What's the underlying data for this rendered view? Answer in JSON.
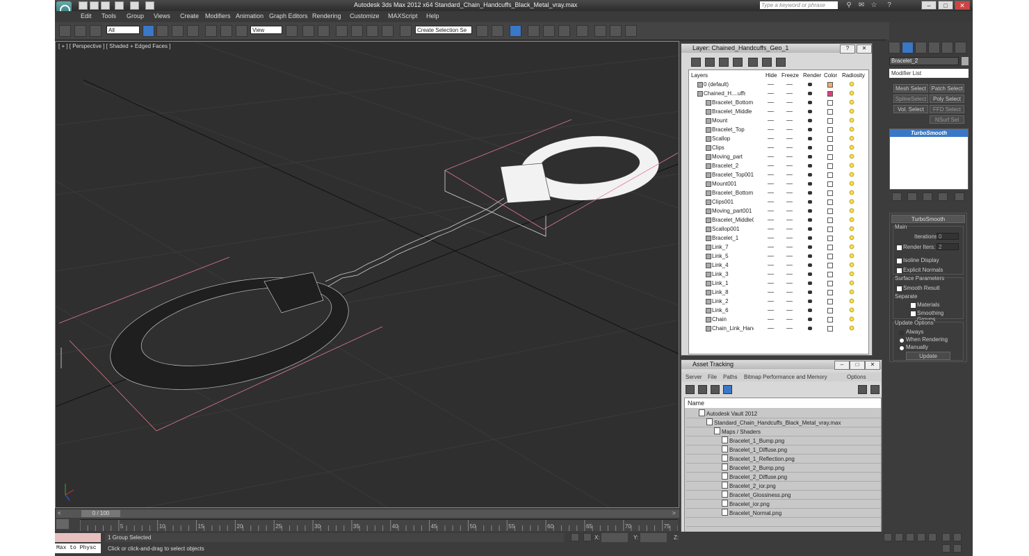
{
  "app": {
    "title": "Autodesk 3ds Max  2012 x64      Standard_Chain_Handcuffs_Black_Metal_vray.max",
    "search_placeholder": "Type a keyword or phrase"
  },
  "menu": [
    "Edit",
    "Tools",
    "Group",
    "Views",
    "Create",
    "Modifiers",
    "Animation",
    "Graph Editors",
    "Rendering",
    "Customize",
    "MAXScript",
    "Help"
  ],
  "toolbar": {
    "filter_select": "All",
    "refcoord_select": "View",
    "selection_set": "Create Selection Se"
  },
  "viewport": {
    "label": "[ + ] [ Perspective ] [ Shaded + Edged Faces ]"
  },
  "layer_panel": {
    "title": "Layer: Chained_Handcuffs_Geo_1",
    "columns": [
      "Layers",
      "Hide",
      "Freeze",
      "Render",
      "Color",
      "Radiosity"
    ],
    "rows": [
      {
        "name": "0 (default)",
        "color": "#e8b070"
      },
      {
        "name": "Chained_H....uffs_G",
        "color": "#e0407a"
      },
      {
        "name": "Bracelet_Bottom"
      },
      {
        "name": "Bracelet_Middle"
      },
      {
        "name": "Mount"
      },
      {
        "name": "Bracelet_Top"
      },
      {
        "name": "Scallop"
      },
      {
        "name": "Clips"
      },
      {
        "name": "Moving_part"
      },
      {
        "name": "Bracelet_2"
      },
      {
        "name": "Bracelet_Top001"
      },
      {
        "name": "Mount001"
      },
      {
        "name": "Bracelet_Bottom"
      },
      {
        "name": "Clips001"
      },
      {
        "name": "Moving_part001"
      },
      {
        "name": "Bracelet_MiddleC"
      },
      {
        "name": "Scallop001"
      },
      {
        "name": "Bracelet_1"
      },
      {
        "name": "Link_7"
      },
      {
        "name": "Link_5"
      },
      {
        "name": "Link_4"
      },
      {
        "name": "Link_3"
      },
      {
        "name": "Link_1"
      },
      {
        "name": "Link_8"
      },
      {
        "name": "Link_2"
      },
      {
        "name": "Link_6"
      },
      {
        "name": "Chain"
      },
      {
        "name": "Chain_Link_Hanc"
      }
    ]
  },
  "asset_panel": {
    "title": "Asset Tracking",
    "menu": [
      "Server",
      "File",
      "Paths",
      "Bitmap Performance and Memory",
      "Options"
    ],
    "column": "Name",
    "rows": [
      {
        "name": "Autodesk Vault 2012",
        "level": 0
      },
      {
        "name": "Standard_Chain_Handcuffs_Black_Metal_vray.max",
        "level": 1
      },
      {
        "name": "Maps / Shaders",
        "level": 2
      },
      {
        "name": "Bracelet_1_Bump.png",
        "level": 3
      },
      {
        "name": "Bracelet_1_Diffuse.png",
        "level": 3
      },
      {
        "name": "Bracelet_1_Reflection.png",
        "level": 3
      },
      {
        "name": "Bracelet_2_Bump.png",
        "level": 3
      },
      {
        "name": "Bracelet_2_Diffuse.png",
        "level": 3
      },
      {
        "name": "Bracelet_2_ior.png",
        "level": 3
      },
      {
        "name": "Bracelet_Glossiness.png",
        "level": 3
      },
      {
        "name": "Bracelet_ior.png",
        "level": 3
      },
      {
        "name": "Bracelet_Normal.png",
        "level": 3
      }
    ]
  },
  "command_panel": {
    "object_name": "Bracelet_2",
    "modifier_list": "Modifier List",
    "buttons": [
      "Mesh Select",
      "Patch Select",
      "SplineSelect",
      "Poly Select",
      "Vol. Select",
      "FFD Select",
      "NSurf Sel"
    ],
    "stack_item": "TurboSmooth",
    "rollout_title": "TurboSmooth",
    "main_label": "Main",
    "iterations_label": "Iterations:",
    "iterations_value": "0",
    "render_iters_label": "Render Iters:",
    "render_iters_value": "2",
    "isoline": "Isoline Display",
    "explicit_normals": "Explicit Normals",
    "surface_params": "Surface Parameters",
    "smooth_result": "Smooth Result",
    "separate": "Separate",
    "materials": "Materials",
    "smoothing_groups": "Smoothing Groups",
    "update_options": "Update Options",
    "always": "Always",
    "when_rendering": "When Rendering",
    "manually": "Manually",
    "update_btn": "Update"
  },
  "timeline": {
    "frame": "0 / 100",
    "ticks": [
      "5",
      "10",
      "15",
      "20",
      "25",
      "30",
      "35",
      "40",
      "45",
      "50",
      "55",
      "60",
      "65",
      "70",
      "75"
    ]
  },
  "status": {
    "listener": "Max to Physc",
    "selected": "1 Group Selected",
    "prompt": "Click or click-and-drag to select objects",
    "x_label": "X:",
    "y_label": "Y:",
    "z_label": "Z:"
  }
}
